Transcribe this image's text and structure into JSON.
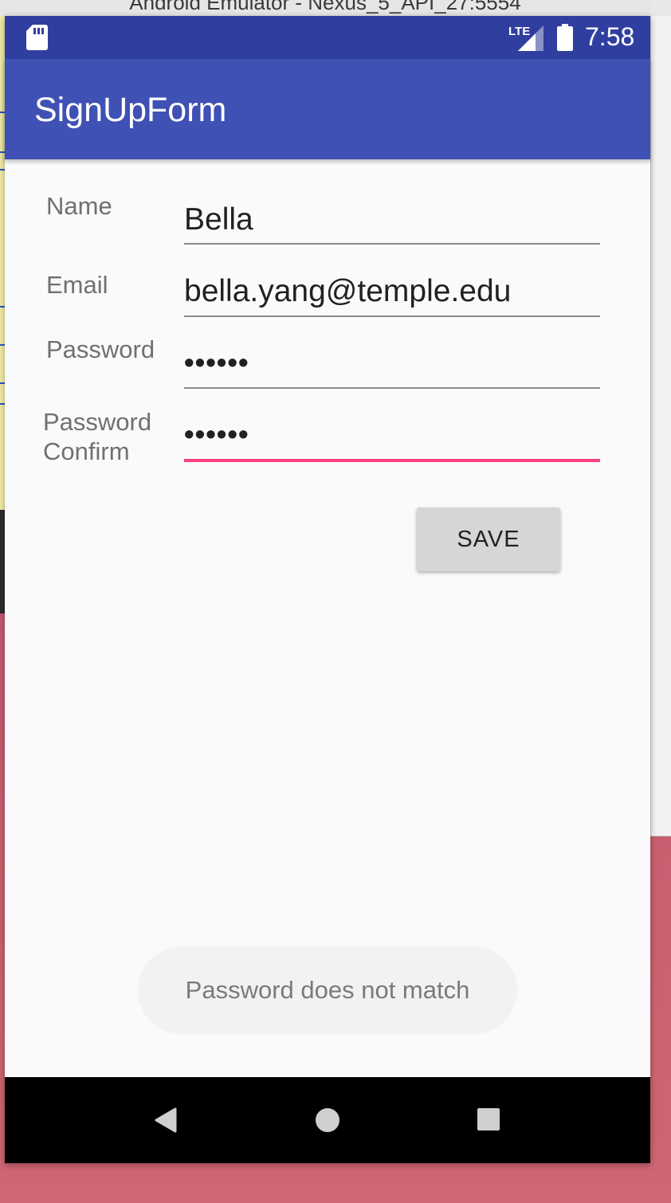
{
  "window": {
    "title": "Android Emulator - Nexus_5_API_27:5554"
  },
  "status_bar": {
    "time": "7:58",
    "network": "LTE",
    "icons": [
      "sd-card-icon",
      "lte-signal-icon",
      "battery-icon"
    ]
  },
  "app_bar": {
    "title": "SignUpForm"
  },
  "form": {
    "name_label": "Name",
    "name_value": "Bella",
    "email_label": "Email",
    "email_value": "bella.yang@temple.edu",
    "password_label": "Password",
    "password_value": "••••••",
    "password_confirm_label_line1": "Password",
    "password_confirm_label_line2": "Confirm",
    "password_confirm_value": "••••••",
    "save_label": "SAVE"
  },
  "toast": {
    "message": "Password does not match"
  },
  "nav_bar": {
    "icons": [
      "back-icon",
      "home-icon",
      "recents-icon"
    ]
  },
  "colors": {
    "status_bar": "#303f9f",
    "app_bar": "#3f51b5",
    "accent": "#ff4081",
    "background": "#fafafa",
    "button": "#d6d6d6"
  }
}
